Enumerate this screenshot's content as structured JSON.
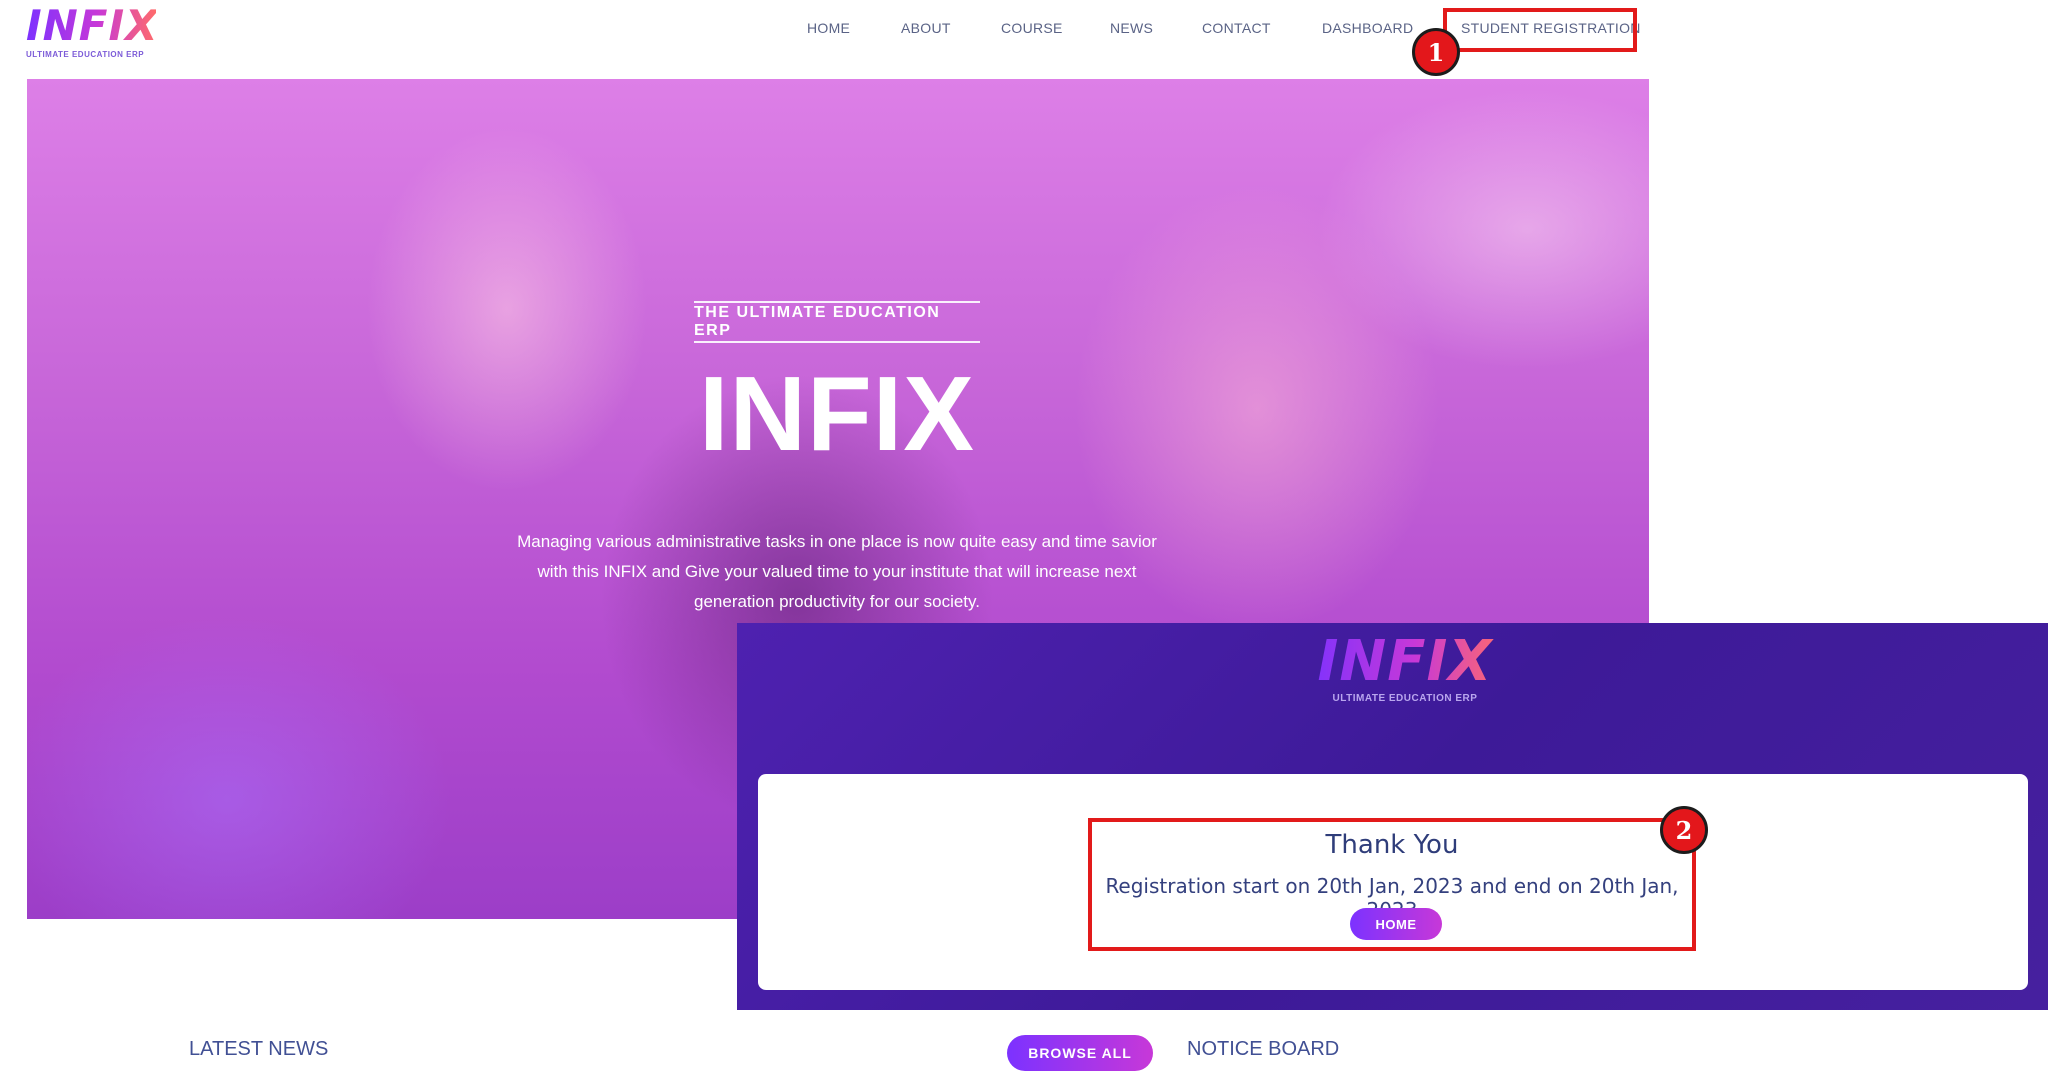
{
  "header": {
    "logo": {
      "word": "INFIX",
      "tagline": "ULTIMATE EDUCATION ERP"
    },
    "nav": [
      {
        "label": "HOME"
      },
      {
        "label": "ABOUT"
      },
      {
        "label": "COURSE"
      },
      {
        "label": "NEWS"
      },
      {
        "label": "CONTACT"
      },
      {
        "label": "DASHBOARD"
      },
      {
        "label": "STUDENT REGISTRATION"
      }
    ]
  },
  "hero": {
    "tagline": "THE ULTIMATE EDUCATION ERP",
    "title": "INFIX",
    "description": "Managing various administrative tasks in one place is now quite easy and time savior with this INFIX and Give your valued time to your institute that will increase next generation productivity for our society."
  },
  "registration_panel": {
    "logo": {
      "word": "INFIX",
      "tagline": "ULTIMATE EDUCATION ERP"
    },
    "title": "Thank You",
    "message": "Registration start on 20th Jan, 2023 and end on 20th Jan, 2023",
    "home_button": "HOME"
  },
  "callouts": [
    "1",
    "2"
  ],
  "bottom": {
    "latest_news": "LATEST NEWS",
    "browse_all": "BROWSE ALL",
    "notice_board": "NOTICE BOARD"
  },
  "colors": {
    "brand_purple": "#7c32ff",
    "brand_pink": "#c738d8",
    "highlight_red": "#e21a1a",
    "text_navy": "#415094",
    "panel_bg": "#4e21b0"
  }
}
